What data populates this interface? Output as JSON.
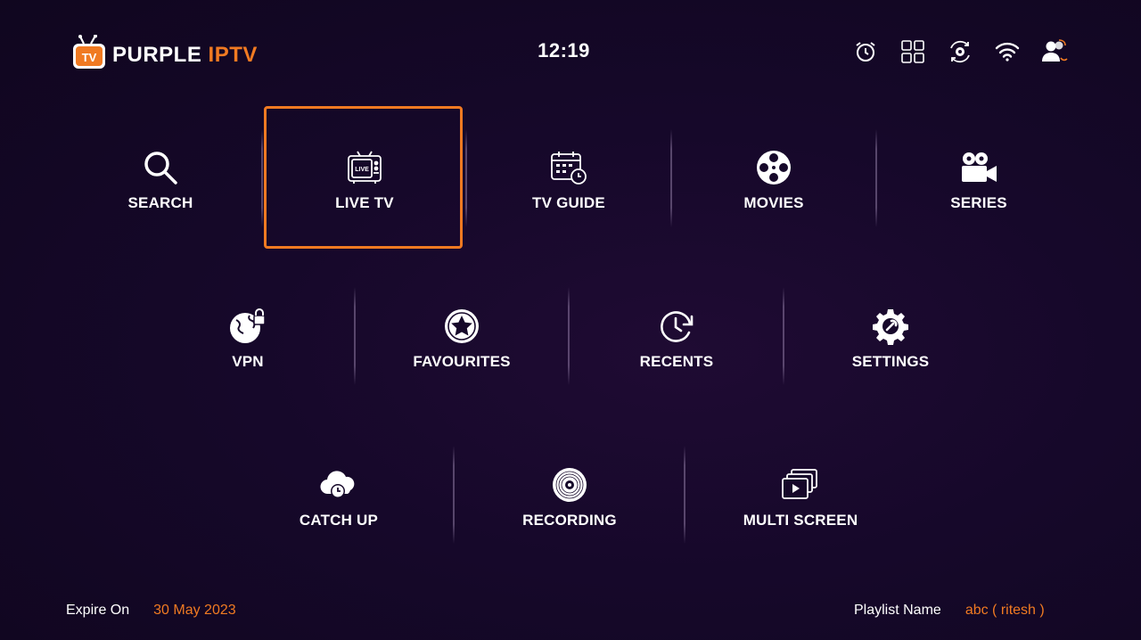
{
  "app": {
    "logo_part1": "PURPLE",
    "logo_part2": "IPTV",
    "logo_badge": "TV",
    "clock": "12:19",
    "accent_color": "#f07a22"
  },
  "header_icons": [
    "alarm-clock-icon",
    "multiview-grid-icon",
    "settings-sync-icon",
    "wifi-icon",
    "user-switch-icon"
  ],
  "menu": {
    "row1": [
      {
        "label": "SEARCH",
        "icon": "search-icon"
      },
      {
        "label": "LIVE TV",
        "icon": "live-tv-icon",
        "selected": true
      },
      {
        "label": "TV GUIDE",
        "icon": "calendar-clock-icon"
      },
      {
        "label": "MOVIES",
        "icon": "film-reel-icon"
      },
      {
        "label": "SERIES",
        "icon": "video-camera-icon"
      }
    ],
    "row2": [
      {
        "label": "VPN",
        "icon": "globe-lock-icon"
      },
      {
        "label": "FAVOURITES",
        "icon": "star-icon"
      },
      {
        "label": "RECENTS",
        "icon": "history-clock-icon"
      },
      {
        "label": "SETTINGS",
        "icon": "gear-wrench-icon"
      }
    ],
    "row3": [
      {
        "label": "CATCH UP",
        "icon": "cloud-clock-icon"
      },
      {
        "label": "RECORDING",
        "icon": "vinyl-disc-icon"
      },
      {
        "label": "MULTI SCREEN",
        "icon": "stacked-screens-icon"
      }
    ]
  },
  "footer": {
    "expire_label": "Expire On",
    "expire_value": "30 May 2023",
    "playlist_label": "Playlist Name",
    "playlist_value": "abc ( ritesh )"
  }
}
